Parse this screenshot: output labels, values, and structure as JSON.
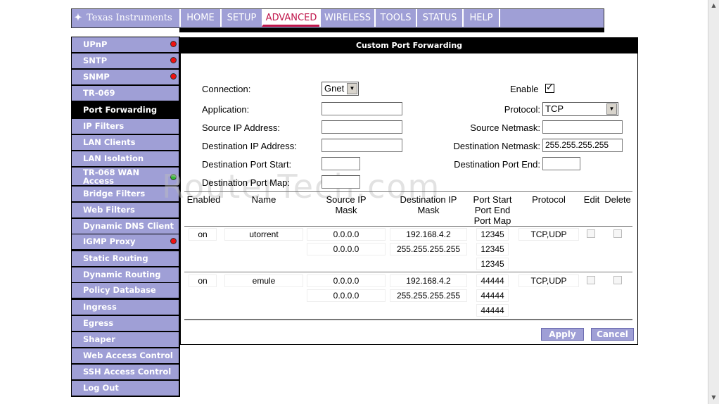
{
  "brand": {
    "logo_text": "Texas Instruments",
    "logo_mark": "ti-logo-icon"
  },
  "nav": {
    "tabs": [
      {
        "label": "HOME"
      },
      {
        "label": "SETUP"
      },
      {
        "label": "ADVANCED"
      },
      {
        "label": "WIRELESS"
      },
      {
        "label": "TOOLS"
      },
      {
        "label": "STATUS"
      },
      {
        "label": "HELP"
      }
    ],
    "active": "ADVANCED"
  },
  "sidebar": {
    "items": [
      {
        "label": "UPnP",
        "status": "red"
      },
      {
        "label": "SNTP",
        "status": "red"
      },
      {
        "label": "SNMP",
        "status": "red"
      },
      {
        "label": "TR-069"
      },
      {
        "label": "Port Forwarding",
        "active": true
      },
      {
        "label": "IP Filters"
      },
      {
        "label": "LAN Clients"
      },
      {
        "label": "LAN Isolation"
      },
      {
        "label": "TR-068 WAN Access",
        "status": "green"
      },
      {
        "label": "Bridge Filters"
      },
      {
        "label": "Web Filters"
      },
      {
        "label": "Dynamic DNS Client"
      },
      {
        "label": "IGMP Proxy",
        "status": "red"
      },
      {
        "label": "Static Routing"
      },
      {
        "label": "Dynamic Routing"
      },
      {
        "label": "Policy Database"
      },
      {
        "label": "Ingress"
      },
      {
        "label": "Egress"
      },
      {
        "label": "Shaper"
      },
      {
        "label": "Web Access Control"
      },
      {
        "label": "SSH Access Control"
      },
      {
        "label": "Log Out"
      }
    ]
  },
  "panel": {
    "title": "Custom Port Forwarding",
    "form": {
      "connection_label": "Connection:",
      "connection_value": "Gnet",
      "enable_label": "Enable",
      "enable_checked": true,
      "application_label": "Application:",
      "application_value": "",
      "protocol_label": "Protocol:",
      "protocol_value": "TCP",
      "source_ip_label": "Source IP Address:",
      "source_ip_value": "",
      "source_netmask_label": "Source Netmask:",
      "source_netmask_value": "",
      "dest_ip_label": "Destination IP Address:",
      "dest_ip_value": "",
      "dest_netmask_label": "Destination Netmask:",
      "dest_netmask_value": "255.255.255.255",
      "dest_port_start_label": "Destination Port Start:",
      "dest_port_start_value": "",
      "dest_port_end_label": "Destination Port End:",
      "dest_port_end_value": "",
      "dest_port_map_label": "Destination Port Map:",
      "dest_port_map_value": ""
    },
    "table": {
      "headers": {
        "enabled": "Enabled",
        "name": "Name",
        "source_ip": "Source IP",
        "source_mask": "Mask",
        "dest_ip": "Destination IP",
        "dest_mask": "Mask",
        "port_start": "Port Start",
        "port_end": "Port End",
        "port_map": "Port Map",
        "protocol": "Protocol",
        "edit": "Edit",
        "delete": "Delete"
      },
      "rows": [
        {
          "enabled": "on",
          "name": "utorrent",
          "source_ip": "0.0.0.0",
          "source_mask": "0.0.0.0",
          "dest_ip": "192.168.4.2",
          "dest_mask": "255.255.255.255",
          "port_start": "12345",
          "port_end": "12345",
          "port_map": "12345",
          "protocol": "TCP,UDP"
        },
        {
          "enabled": "on",
          "name": "emule",
          "source_ip": "0.0.0.0",
          "source_mask": "0.0.0.0",
          "dest_ip": "192.168.4.2",
          "dest_mask": "255.255.255.255",
          "port_start": "44444",
          "port_end": "44444",
          "port_map": "44444",
          "protocol": "TCP,UDP"
        }
      ]
    },
    "buttons": {
      "apply": "Apply",
      "cancel": "Cancel"
    }
  },
  "watermark": "RouterTech.com",
  "colors": {
    "nav_bg": "#9f9fd6",
    "active_tab_text": "#c0164b",
    "header_bg": "#000000"
  }
}
